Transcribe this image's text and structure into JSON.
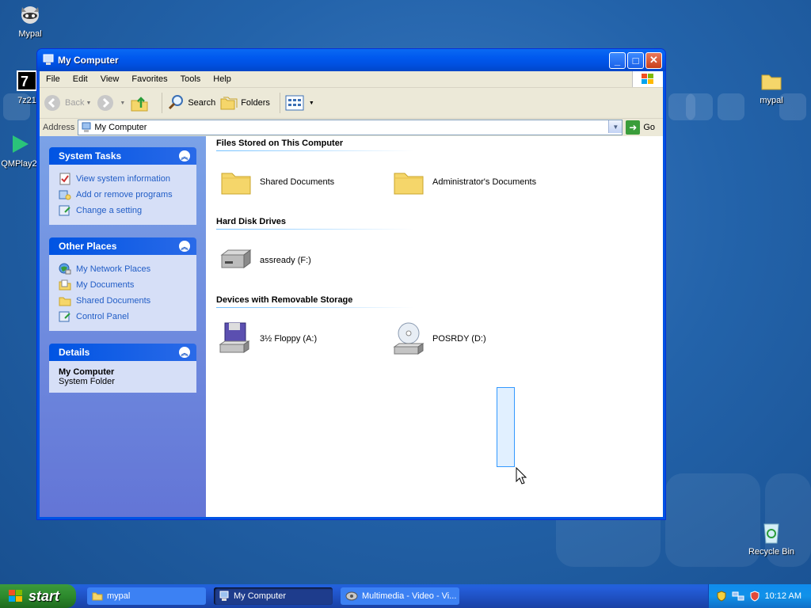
{
  "desktop": {
    "icons": [
      {
        "label": "Mypal"
      },
      {
        "label": "7z21"
      },
      {
        "label": "QMPlay2"
      },
      {
        "label": "mypal"
      },
      {
        "label": "Recycle Bin"
      }
    ]
  },
  "window": {
    "title": "My Computer",
    "controls": {
      "minimize": "_",
      "maximize": "□",
      "close": "✕"
    },
    "menu": [
      "File",
      "Edit",
      "View",
      "Favorites",
      "Tools",
      "Help"
    ],
    "toolbar": {
      "back": "Back",
      "search": "Search",
      "folders": "Folders"
    },
    "address": {
      "label": "Address",
      "value": "My Computer",
      "go": "Go"
    }
  },
  "left_pane": {
    "system_tasks": {
      "title": "System Tasks",
      "items": [
        "View system information",
        "Add or remove programs",
        "Change a setting"
      ]
    },
    "other_places": {
      "title": "Other Places",
      "items": [
        "My Network Places",
        "My Documents",
        "Shared Documents",
        "Control Panel"
      ]
    },
    "details": {
      "title": "Details",
      "name": "My Computer",
      "type": "System Folder"
    }
  },
  "content": {
    "groups": [
      {
        "title": "Files Stored on This Computer",
        "items": [
          "Shared Documents",
          "Administrator's Documents"
        ]
      },
      {
        "title": "Hard Disk Drives",
        "items": [
          "assready (F:)"
        ]
      },
      {
        "title": "Devices with Removable Storage",
        "items": [
          "3½ Floppy (A:)",
          "POSRDY (D:)"
        ]
      }
    ]
  },
  "taskbar": {
    "start": "start",
    "tasks": [
      "mypal",
      "My Computer",
      "Multimedia - Video - Vi..."
    ],
    "clock": "10:12 AM"
  }
}
